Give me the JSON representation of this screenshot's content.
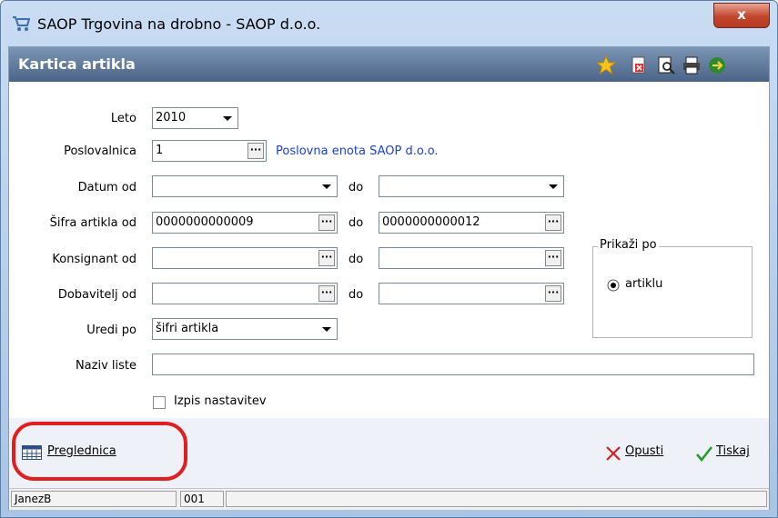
{
  "window": {
    "title": "SAOP Trgovina na drobno - SAOP d.o.o.",
    "close_label": "x"
  },
  "header": {
    "title": "Kartica artikla"
  },
  "form": {
    "leto": {
      "label": "Leto",
      "value": "2010"
    },
    "poslovalnica": {
      "label": "Poslovalnica",
      "value": "1",
      "info": "Poslovna enota SAOP d.o.o."
    },
    "datum": {
      "label": "Datum od",
      "from": "",
      "to": ""
    },
    "sifra": {
      "label": "Šifra artikla od",
      "from": "0000000000009",
      "to": "0000000000012"
    },
    "konsignant": {
      "label": "Konsignant od",
      "from": "",
      "to": ""
    },
    "dobavitelj": {
      "label": "Dobavitelj od",
      "from": "",
      "to": ""
    },
    "do_label": "do",
    "uredi": {
      "label": "Uredi po",
      "value": "šifri artikla"
    },
    "naziv": {
      "label": "Naziv liste",
      "value": ""
    },
    "izpis": {
      "label": "Izpis nastavitev",
      "checked": false
    },
    "prikazi": {
      "title": "Prikaži po",
      "option": "artiklu",
      "selected": true
    }
  },
  "footer": {
    "preglednica": "Preglednica",
    "opusti": "Opusti",
    "tiskaj": "Tiskaj"
  },
  "status": {
    "user": "JanezB",
    "code": "001"
  },
  "colors": {
    "header": "#5c7496",
    "info_link": "#1a3fd0",
    "highlight": "#e02020"
  }
}
